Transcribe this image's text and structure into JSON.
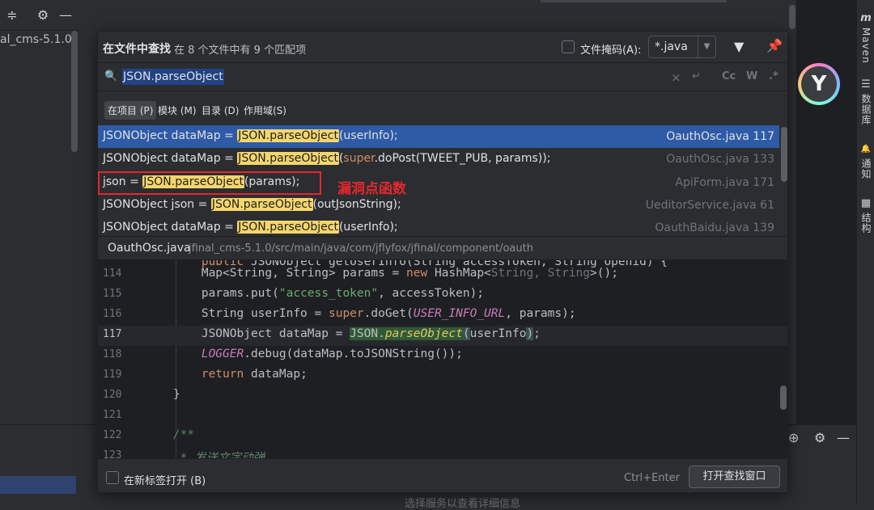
{
  "ide": {
    "project_text": "al_cms-5.1.0",
    "right_bar": [
      {
        "glyph": "m",
        "label": "Maven"
      },
      {
        "glyph": "☰",
        "label": "数据库"
      },
      {
        "glyph": "🔔",
        "label": "通知"
      },
      {
        "glyph": "▦",
        "label": "结构"
      }
    ],
    "bottom_status": "选择服务以查看详细信息"
  },
  "popup": {
    "title": "在文件中查找",
    "subtitle": "在 8 个文件中有 9 个匹配项",
    "file_mask_label": "文件掩码(A):",
    "file_mask_value": "*.java",
    "search_query": "JSON.parseObject",
    "search_options": [
      "Cc",
      "W",
      ".*"
    ],
    "scopes": [
      {
        "label": "在项目 (P)",
        "active": true
      },
      {
        "label": "模块 (M)",
        "active": false
      },
      {
        "label": "目录 (D)",
        "active": false
      },
      {
        "label": "作用域(S)",
        "active": false
      }
    ],
    "results": [
      {
        "before": "JSONObject dataMap = ",
        "match": "JSON.parseObject",
        "after": "(userInfo);",
        "file": "OauthOsc.java 117"
      },
      {
        "before": "JSONObject dataMap = ",
        "match": "JSON.parseObject",
        "after_kw": "super",
        "after": ".doPost(TWEET_PUB, params));",
        "file": "OauthOsc.java 133"
      },
      {
        "before": "json = ",
        "match": "JSON.parseObject",
        "after": "(params);",
        "file": "ApiForm.java 171"
      },
      {
        "before": "JSONObject json = ",
        "match": "JSON.parseObject",
        "after": "(outJsonString);",
        "file": "UeditorService.java 61"
      },
      {
        "before": "JSONObject dataMap = ",
        "match": "JSON.parseObject",
        "after": "(userInfo);",
        "file": "OauthBaidu.java 139"
      }
    ],
    "annotation": "漏洞点函数",
    "path_file": "OauthOsc.java",
    "path_dir": "jfinal_cms-5.1.0/src/main/java/com/jflyfox/jfinal/component/oauth",
    "code_line_numbers": [
      "114",
      "115",
      "116",
      "117",
      "118",
      "119",
      "120",
      "121",
      "122",
      "123"
    ],
    "footer": {
      "new_tab_label": "在新标签打开 (B)",
      "shortcut": "Ctrl+Enter",
      "open_button": "打开查找窗口"
    }
  }
}
